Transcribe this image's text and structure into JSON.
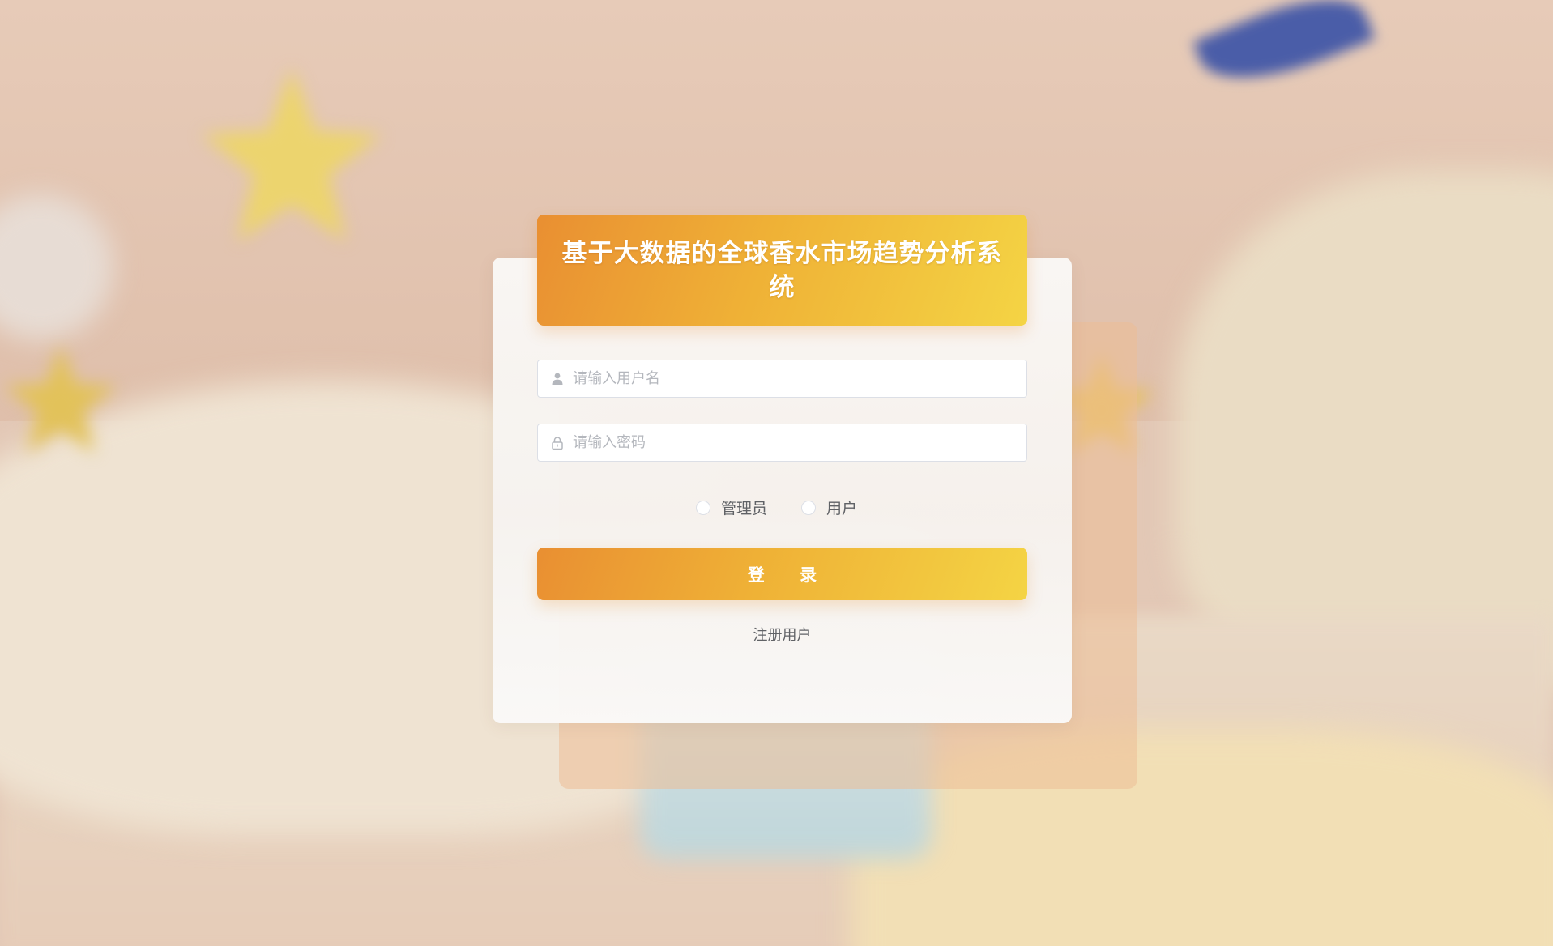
{
  "app": {
    "title": "基于大数据的全球香水市场趋势分析系统"
  },
  "login_form": {
    "username_placeholder": "请输入用户名",
    "password_placeholder": "请输入密码",
    "roles": [
      {
        "label": "管理员",
        "selected": false
      },
      {
        "label": "用户",
        "selected": false
      }
    ],
    "login_label": "登 录",
    "register_label": "注册用户"
  },
  "icons": {
    "username": "user-icon",
    "password": "lock-icon"
  },
  "colors": {
    "accent_start": "#e98f32",
    "accent_end": "#f4d444",
    "placeholder": "#b4b7bd",
    "text": "#606266"
  }
}
